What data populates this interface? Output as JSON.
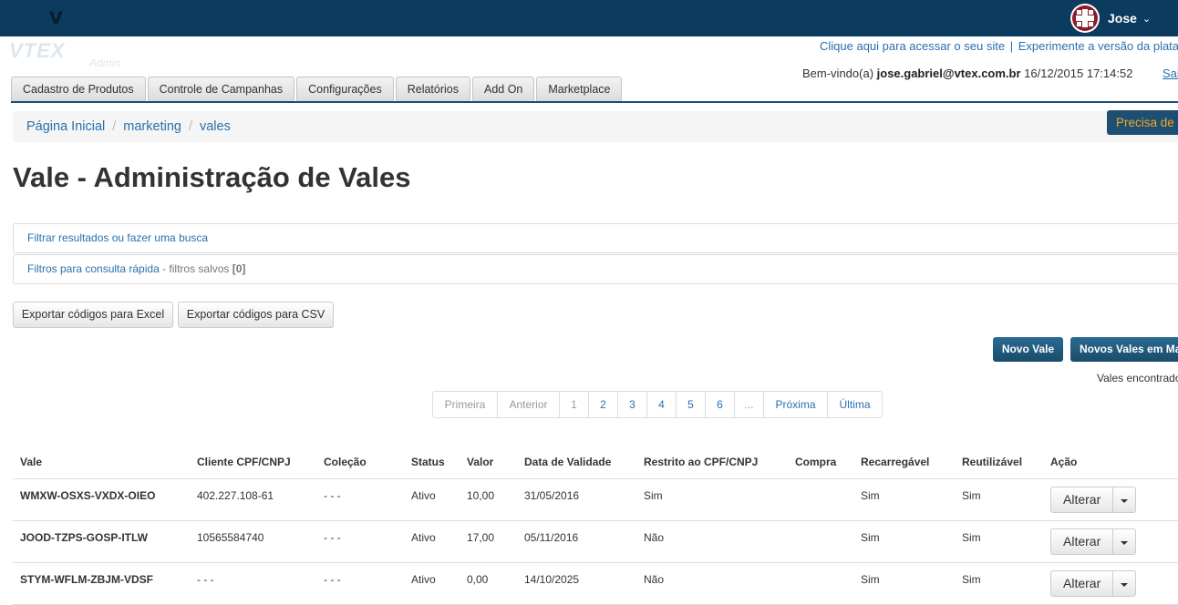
{
  "topbar": {
    "logo": "V",
    "user_name": "Jose",
    "caret": "⌄"
  },
  "logo": {
    "word": "VTEX",
    "sub": "Admin"
  },
  "header": {
    "site_link": "Clique aqui para acessar o seu site",
    "separator": "|",
    "new_version_link": "Experimente a versão da plataforma",
    "welcome_prefix": "Bem-vindo(a) ",
    "email": "jose.gabriel@vtex.com.br",
    "datetime": " 16/12/2015 17:14:52",
    "logout": "Sair"
  },
  "tabs": [
    "Cadastro de Produtos",
    "Controle de Campanhas",
    "Configurações",
    "Relatórios",
    "Add On",
    "Marketplace"
  ],
  "breadcrumb": [
    "Página Inicial",
    "marketing",
    "vales"
  ],
  "help_button": "Precisa de ajuda?",
  "page_title": "Vale - Administração de Vales",
  "filters": {
    "search": "Filtrar resultados ou fazer uma busca",
    "quick": "Filtros para consulta rápida",
    "saved_prefix": " - filtros salvos ",
    "saved_count": "[0]"
  },
  "export": {
    "excel": "Exportar códigos para Excel",
    "csv": "Exportar códigos para CSV"
  },
  "actions": {
    "new": "Novo Vale",
    "new_bulk": "Novos Vales em Massa"
  },
  "found_text": "Vales encontrados",
  "pagination": [
    "Primeira",
    "Anterior",
    "1",
    "2",
    "3",
    "4",
    "5",
    "6",
    "...",
    "Próxima",
    "Última"
  ],
  "table": {
    "headers": [
      "Vale",
      "Cliente CPF/CNPJ",
      "Coleção",
      "Status",
      "Valor",
      "Data de Validade",
      "Restrito ao CPF/CNPJ",
      "Compra",
      "Recarregável",
      "Reutilizável",
      "Ação"
    ],
    "rows": [
      [
        "WMXW-OSXS-VXDX-OIEO",
        "402.227.108-61",
        "- - -",
        "Ativo",
        "10,00",
        "31/05/2016",
        "Sim",
        "",
        "Sim",
        "Sim"
      ],
      [
        "JOOD-TZPS-GOSP-ITLW",
        "10565584740",
        "- - -",
        "Ativo",
        "17,00",
        "05/11/2016",
        "Não",
        "",
        "Sim",
        "Sim"
      ],
      [
        "STYM-WFLM-ZBJM-VDSF",
        "- - -",
        "- - -",
        "Ativo",
        "0,00",
        "14/10/2025",
        "Não",
        "",
        "Sim",
        "Sim"
      ]
    ],
    "action_label": "Alterar"
  }
}
